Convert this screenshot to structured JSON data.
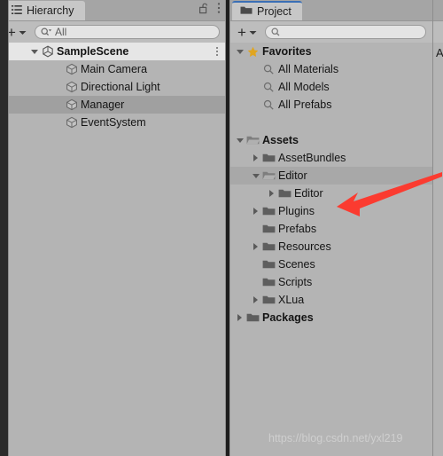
{
  "hierarchy_panel": {
    "tab": {
      "label": "Hierarchy",
      "icon": "hierarchy-list-icon"
    },
    "lock_icon": "unlocked-padlock-icon",
    "menu_icon": "kebab-menu-icon",
    "toolbar": {
      "add_label": "+",
      "add_dropdown_icon": "chevron-down-icon",
      "search_icon": "search-dropdown-icon",
      "search_value": "All",
      "search_placeholder": "All"
    },
    "rows": [
      {
        "label": "SampleScene",
        "indent": 0,
        "twisty": "down",
        "icon": "unity-scene-icon",
        "bold": true,
        "state": "sel-light",
        "kebab": true
      },
      {
        "label": "Main Camera",
        "indent": 1,
        "twisty": "none",
        "icon": "game-object-icon",
        "bold": false,
        "state": "none",
        "kebab": false
      },
      {
        "label": "Directional Light",
        "indent": 1,
        "twisty": "none",
        "icon": "game-object-icon",
        "bold": false,
        "state": "none",
        "kebab": false
      },
      {
        "label": "Manager",
        "indent": 1,
        "twisty": "none",
        "icon": "game-object-icon",
        "bold": false,
        "state": "sel-mid",
        "kebab": false
      },
      {
        "label": "EventSystem",
        "indent": 1,
        "twisty": "none",
        "icon": "game-object-icon",
        "bold": false,
        "state": "none",
        "kebab": false
      }
    ]
  },
  "project_panel": {
    "tab": {
      "label": "Project",
      "icon": "folder-icon"
    },
    "toolbar": {
      "add_label": "+",
      "add_dropdown_icon": "chevron-down-icon",
      "search_icon": "search-icon",
      "search_value": "",
      "search_placeholder": ""
    },
    "rows": [
      {
        "label": "Favorites",
        "indent": 0,
        "twisty": "down",
        "icon": "star-icon",
        "bold": true,
        "state": "none"
      },
      {
        "label": "All Materials",
        "indent": 1,
        "twisty": "none",
        "icon": "search-icon",
        "bold": false,
        "state": "none"
      },
      {
        "label": "All Models",
        "indent": 1,
        "twisty": "none",
        "icon": "search-icon",
        "bold": false,
        "state": "none"
      },
      {
        "label": "All Prefabs",
        "indent": 1,
        "twisty": "none",
        "icon": "search-icon",
        "bold": false,
        "state": "none"
      },
      {
        "label": "",
        "indent": 0,
        "twisty": "none",
        "icon": "none",
        "bold": false,
        "state": "none"
      },
      {
        "label": "Assets",
        "indent": 0,
        "twisty": "down",
        "icon": "folder-open-icon",
        "bold": true,
        "state": "none"
      },
      {
        "label": "AssetBundles",
        "indent": 1,
        "twisty": "right",
        "icon": "folder-icon",
        "bold": false,
        "state": "none"
      },
      {
        "label": "Editor",
        "indent": 1,
        "twisty": "down",
        "icon": "folder-open-icon",
        "bold": false,
        "state": "sel-proj"
      },
      {
        "label": "Editor",
        "indent": 2,
        "twisty": "right",
        "icon": "folder-icon",
        "bold": false,
        "state": "none"
      },
      {
        "label": "Plugins",
        "indent": 1,
        "twisty": "right",
        "icon": "folder-icon",
        "bold": false,
        "state": "none"
      },
      {
        "label": "Prefabs",
        "indent": 1,
        "twisty": "none",
        "icon": "folder-icon",
        "bold": false,
        "state": "none"
      },
      {
        "label": "Resources",
        "indent": 1,
        "twisty": "right",
        "icon": "folder-icon",
        "bold": false,
        "state": "none"
      },
      {
        "label": "Scenes",
        "indent": 1,
        "twisty": "none",
        "icon": "folder-icon",
        "bold": false,
        "state": "none"
      },
      {
        "label": "Scripts",
        "indent": 1,
        "twisty": "none",
        "icon": "folder-icon",
        "bold": false,
        "state": "none"
      },
      {
        "label": "XLua",
        "indent": 1,
        "twisty": "right",
        "icon": "folder-icon",
        "bold": false,
        "state": "none"
      },
      {
        "label": "Packages",
        "indent": 0,
        "twisty": "right",
        "icon": "folder-icon",
        "bold": true,
        "state": "none"
      }
    ]
  },
  "right_panel": {
    "clipped_label": "A"
  },
  "annotation": {
    "arrow_icon": "red-arrow-pointing-left",
    "color": "#fb3b30",
    "points_at": "Editor"
  },
  "watermark": {
    "text": "https://blog.csdn.net/yxl219"
  },
  "colors": {
    "panel_bg": "#b4b4b4",
    "tabbar_bg": "#a5a5a5",
    "tab_active_bg": "#c7c7c7",
    "tab_accent": "#3b6fb5",
    "toolbar_bg": "#bdbdbd",
    "row_selected_light": "#e6e6e6",
    "row_selected_mid": "#a0a0a0",
    "row_selected_project": "#a8a8a8",
    "text": "#141414",
    "folder": "#5e5e5e",
    "star": "#e0a520",
    "splitter": "#1e1e1e",
    "gutter": "#2b2b2b"
  }
}
